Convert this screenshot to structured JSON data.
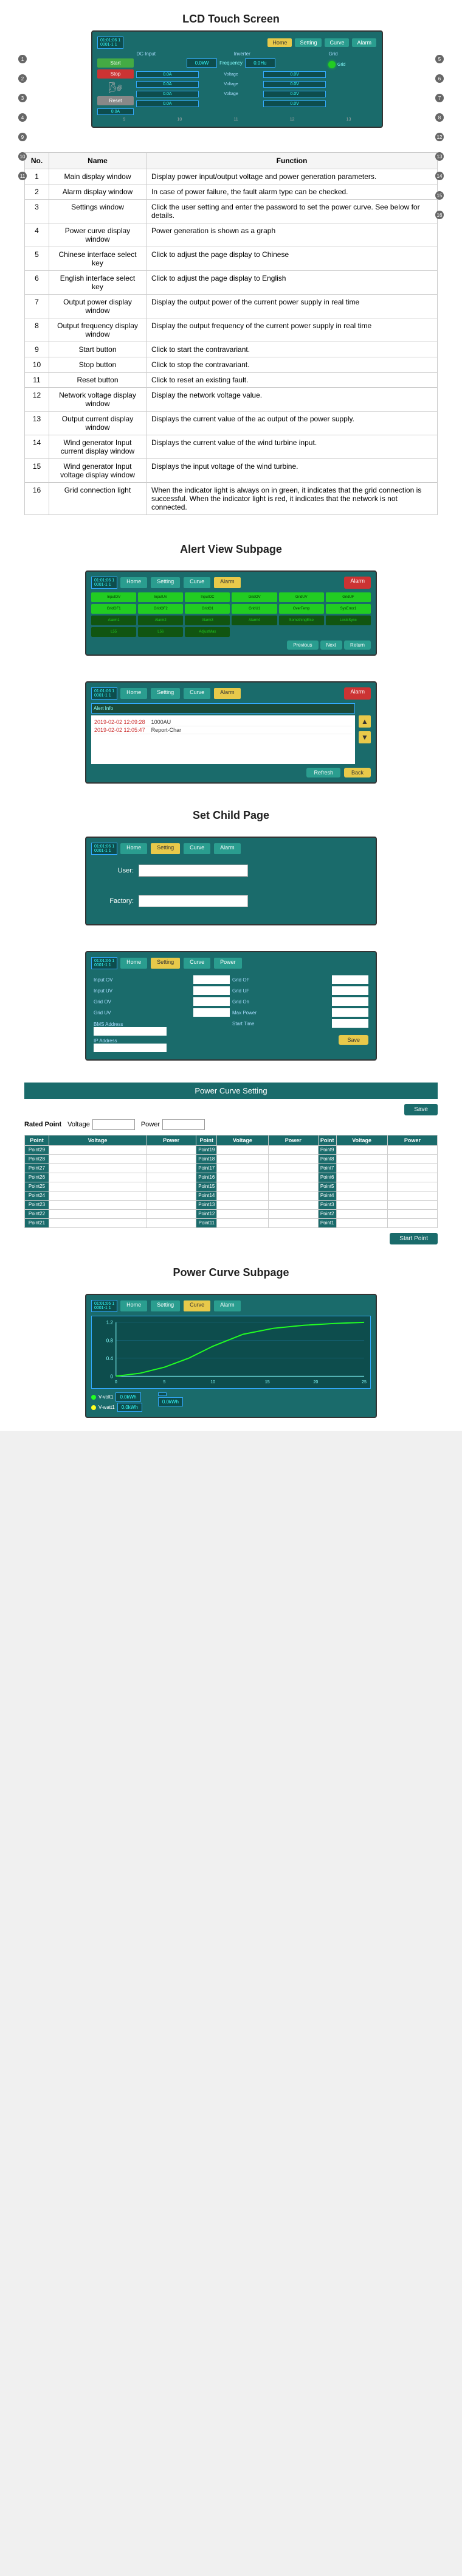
{
  "sections": {
    "lcd_title": "LCD Touch Screen",
    "alert_view_title": "Alert View Subpage",
    "set_child_title": "Set Child Page",
    "power_curve_setting_title": "Power Curve Setting",
    "power_curve_subpage_title": "Power Curve Subpage"
  },
  "lcd_screen": {
    "datetime": "01:01:06 1\n0001-1 1",
    "nav_buttons": [
      "Home",
      "Setting",
      "Curve",
      "Alarm"
    ],
    "labels": {
      "dc_input": "DC Input",
      "inverter": "Inverter",
      "grid": "Grid",
      "frequency": "Frequency"
    },
    "power_values": {
      "left": "0.0kW",
      "right": "0.0Hu"
    },
    "current_values": [
      "0.0A",
      "0.0A",
      "0.0A",
      "0.0A"
    ],
    "voltage_values": [
      "0.0V",
      "0.0V",
      "0.0V"
    ],
    "bottom_values": [
      "0.0V",
      "0.0V",
      "0.0A"
    ],
    "buttons": {
      "start": "Start",
      "stop": "Stop",
      "reset": "Reset"
    }
  },
  "table": {
    "headers": [
      "No.",
      "Name",
      "Function"
    ],
    "rows": [
      {
        "no": "1",
        "name": "Main display window",
        "func": "Display power input/output voltage and power generation parameters."
      },
      {
        "no": "2",
        "name": "Alarm display window",
        "func": "In case of power failure, the fault alarm type can be checked."
      },
      {
        "no": "3",
        "name": "Settings window",
        "func": "Click the user setting and enter the password to set the power curve. See below for details."
      },
      {
        "no": "4",
        "name": "Power curve display window",
        "func": "Power generation is shown as a graph"
      },
      {
        "no": "5",
        "name": "Chinese interface select key",
        "func": "Click to adjust the page display to Chinese"
      },
      {
        "no": "6",
        "name": "English interface select key",
        "func": "Click to adjust the page display to English"
      },
      {
        "no": "7",
        "name": "Output power display window",
        "func": "Display the output power of the current power supply in real time"
      },
      {
        "no": "8",
        "name": "Output frequency display window",
        "func": "Display the output frequency of the current power supply in real time"
      },
      {
        "no": "9",
        "name": "Start button",
        "func": "Click to start the contravariant."
      },
      {
        "no": "10",
        "name": "Stop button",
        "func": "Click to stop the contravariant."
      },
      {
        "no": "11",
        "name": "Reset button",
        "func": "Click to reset an existing fault."
      },
      {
        "no": "12",
        "name": "Network voltage display window",
        "func": "Display the network voltage value."
      },
      {
        "no": "13",
        "name": "Output current display window",
        "func": "Displays the current value of the ac output of the power supply."
      },
      {
        "no": "14",
        "name": "Wind generator Input current display window",
        "func": "Displays the current value of the wind turbine input."
      },
      {
        "no": "15",
        "name": "Wind generator Input voltage display window",
        "func": "Displays the input voltage of the wind turbine."
      },
      {
        "no": "16",
        "name": "Grid connection light",
        "func": "When the indicator light is always on in green, it indicates that the grid connection is successful. When the indicator light is red, it indicates that the network is not connected."
      }
    ]
  },
  "alert_view": {
    "nav_buttons": [
      "Home",
      "Setting",
      "Curve",
      "Alarm"
    ],
    "alarm_btn": "Alarm",
    "lights": [
      {
        "label": "InputOV",
        "on": true
      },
      {
        "label": "InputUV",
        "on": true
      },
      {
        "label": "InputOC",
        "on": true
      },
      {
        "label": "GridOV",
        "on": true
      },
      {
        "label": "GridUV",
        "on": true
      },
      {
        "label": "GridUF",
        "on": true
      },
      {
        "label": "GridOF1",
        "on": true
      },
      {
        "label": "GridOF2",
        "on": true
      },
      {
        "label": "GridO1",
        "on": true
      },
      {
        "label": "GridU1",
        "on": true
      },
      {
        "label": "OverTemp",
        "on": true
      },
      {
        "label": "SysError1",
        "on": true
      },
      {
        "label": "Alarm1",
        "on": false
      },
      {
        "label": "Alarm2",
        "on": false
      },
      {
        "label": "Alarm3",
        "on": false
      },
      {
        "label": "Alarm4",
        "on": false
      },
      {
        "label": "SomethingElse",
        "on": false
      },
      {
        "label": "LostsSync",
        "on": false
      },
      {
        "label": "L55",
        "on": false
      },
      {
        "label": "L56",
        "on": false
      },
      {
        "label": "AdjustMax",
        "on": false
      }
    ],
    "action_btns": [
      "Previous",
      "Next",
      "Return"
    ]
  },
  "alert_detail": {
    "nav_buttons": [
      "Home",
      "Setting",
      "Curve",
      "Alarm"
    ],
    "alarm_btn": "Alarm",
    "records": [
      {
        "datetime": "2019-02-02 12:09:28",
        "desc": "1000AU"
      },
      {
        "datetime": "2019-02-02 12:05:47",
        "desc": "Report-Char"
      },
      {
        "datetime": "",
        "desc": ""
      },
      {
        "datetime": "",
        "desc": ""
      },
      {
        "datetime": "",
        "desc": ""
      }
    ],
    "footer_btns": {
      "refresh": "Refresh",
      "back": "Back"
    }
  },
  "set_child": {
    "nav_buttons": [
      "Home",
      "Setting",
      "Curve",
      "Alarm"
    ],
    "fields": [
      {
        "label": "User:",
        "value": ""
      },
      {
        "label": "Factory:",
        "value": ""
      }
    ]
  },
  "settings_sub": {
    "nav_buttons": [
      "Home",
      "Setting",
      "Curve",
      "Power"
    ],
    "fields_left": [
      {
        "label": "Input OV",
        "value": ""
      },
      {
        "label": "Input UV",
        "value": ""
      },
      {
        "label": "Grid OV",
        "value": ""
      },
      {
        "label": "Grid UV",
        "value": ""
      }
    ],
    "fields_right": [
      {
        "label": "Grid OF",
        "value": ""
      },
      {
        "label": "Grid UF",
        "value": ""
      },
      {
        "label": "Grid On",
        "value": ""
      },
      {
        "label": "Max Power",
        "value": ""
      },
      {
        "label": "Start Time",
        "value": ""
      }
    ],
    "extra_fields": [
      {
        "label": "BMS Address",
        "value": ""
      },
      {
        "label": "IP Address",
        "value": ""
      }
    ],
    "save_btn": "Save"
  },
  "power_curve_setting": {
    "header": "Power Curve Setting",
    "rated_point_label": "Rated Point",
    "rated_fields": [
      {
        "label": "Voltage",
        "value": ""
      },
      {
        "label": "Power",
        "value": ""
      }
    ],
    "save_btn": "Save",
    "col_headers": [
      "Point",
      "Voltage",
      "Power"
    ],
    "points_left": [
      "Point29",
      "Point28",
      "Point27",
      "Point26",
      "Point25",
      "Point24",
      "Point23",
      "Point22",
      "Point21"
    ],
    "points_mid": [
      "Point19",
      "Point18",
      "Point17",
      "Point16",
      "Point15",
      "Point14",
      "Point13",
      "Point12",
      "Point11"
    ],
    "points_right": [
      "Point9",
      "Point8",
      "Point7",
      "Point6",
      "Point5",
      "Point4",
      "Point3",
      "Point2",
      "Point1"
    ],
    "start_point_btn": "Start Point"
  },
  "power_curve_sub": {
    "nav_buttons": [
      "Home",
      "Setting",
      "Curve",
      "Alarm"
    ],
    "chart_yaxis": [
      "1.2",
      "0.8",
      "0.4",
      "0"
    ],
    "chart_xaxis": [
      "0",
      "5",
      "10",
      "15",
      "20",
      "25"
    ],
    "status_fields": [
      {
        "label": "V-volt1",
        "value": "0.0kWh"
      },
      {
        "label": "V-watt1",
        "value": "0.0kWh"
      },
      {
        "label": "val1",
        "value": ""
      },
      {
        "label": "val2",
        "value": "0.0kWh"
      }
    ]
  }
}
